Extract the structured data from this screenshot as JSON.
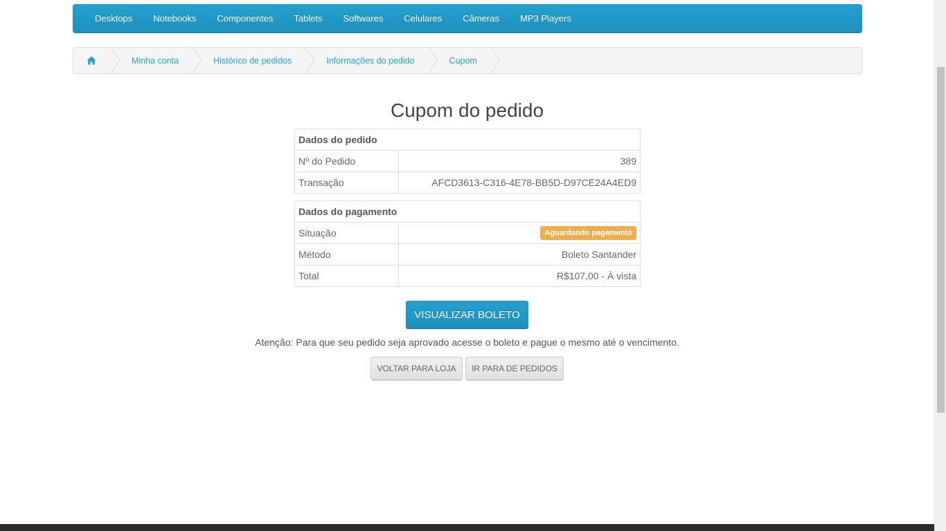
{
  "nav": {
    "items": [
      "Desktops",
      "Notebooks",
      "Componentes",
      "Tablets",
      "Softwares",
      "Celulares",
      "Câmeras",
      "MP3 Players"
    ]
  },
  "breadcrumb": {
    "home_icon": "home-icon",
    "items": [
      "Minha conta",
      "Histórico de pedidos",
      "Informações do pedido",
      "Cupom"
    ]
  },
  "title": "Cupom do pedido",
  "order": {
    "header": "Dados do pedido",
    "number_label": "Nº do Pedido",
    "number_value": "389",
    "transaction_label": "Transação",
    "transaction_value": "AFCD3613-C316-4E78-BB5D-D97CE24A4ED9"
  },
  "payment": {
    "header": "Dados do pagamento",
    "status_label": "Situação",
    "status_value": "Aguardando pagamento",
    "method_label": "Método",
    "method_value": "Boleto Santander",
    "total_label": "Total",
    "total_value": "R$107,00 - À vista"
  },
  "actions": {
    "view_boleto": "VISUALIZAR BOLETO",
    "notice": "Atenção: Para que seu pedido seja aprovado acesse o boleto e pague o mesmo até o vencimento.",
    "back_to_store": "VOLTAR PARA LOJA",
    "go_to_orders": "IR PARA DE PEDIDOS"
  },
  "colors": {
    "accent": "#23a1d1",
    "warning_badge": "#f0ad4e"
  }
}
